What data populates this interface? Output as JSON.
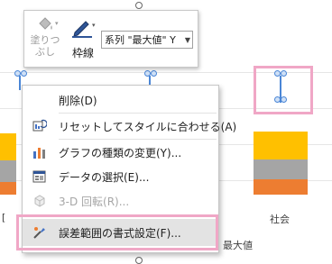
{
  "mini_toolbar": {
    "fill_label_line1": "塗りつ",
    "fill_label_line2": "ぶし",
    "outline_label": "枠線",
    "series_select_value": "系列 \"最大値\" Y"
  },
  "context_menu": {
    "items": [
      {
        "label": "削除(D)",
        "icon": "delete-icon",
        "enabled": true
      },
      {
        "label": "リセットしてスタイルに合わせる(A)",
        "icon": "reset-style-icon",
        "enabled": true
      },
      {
        "label": "グラフの種類の変更(Y)...",
        "icon": "chart-type-icon",
        "enabled": true
      },
      {
        "label": "データの選択(E)...",
        "icon": "select-data-icon",
        "enabled": true
      },
      {
        "label": "3-D 回転(R)...",
        "icon": "rotate-3d-icon",
        "enabled": false
      },
      {
        "label": "誤差範囲の書式設定(F)...",
        "icon": "format-error-bars-icon",
        "enabled": true
      }
    ]
  },
  "chart": {
    "category_label": "社会",
    "legend_text": "最大値",
    "left_axis_fragment": "[",
    "colors": {
      "gold": "#ffc000",
      "gray": "#a5a5a5",
      "orange": "#ed7d31",
      "accent_blue": "#4472c4",
      "highlight_pink": "#f0a7c6"
    }
  }
}
